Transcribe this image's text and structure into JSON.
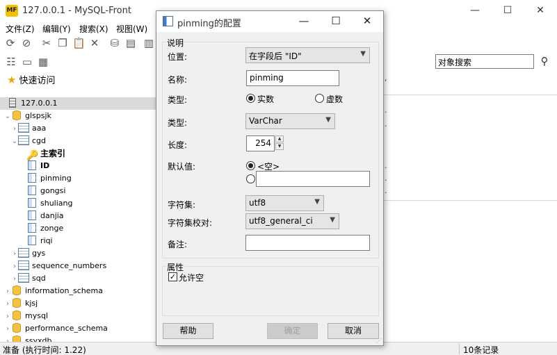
{
  "app": {
    "logo_text": "MF",
    "title": "127.0.0.1 - MySQL-Front"
  },
  "window_controls": {
    "minimize": "—",
    "maximize": "☐",
    "close": "✕"
  },
  "menu": [
    "文件(Z)",
    "编辑(Y)",
    "搜索(X)",
    "视图(W)"
  ],
  "search": {
    "value": "对象搜索"
  },
  "sidebar": {
    "quick_access": "快速访问",
    "tree": [
      {
        "label": "127.0.0.1",
        "icon": "server-icon",
        "selected": true
      },
      {
        "label": "glspsjk",
        "icon": "database-icon",
        "expander": "⌄"
      },
      {
        "label": "aaa",
        "icon": "table-icon",
        "expander": "›"
      },
      {
        "label": "cgd",
        "icon": "table-icon",
        "expander": "⌄"
      },
      {
        "label": "主索引",
        "icon": "key-icon"
      },
      {
        "label": "ID",
        "icon": "column-icon"
      },
      {
        "label": "pinming",
        "icon": "column-icon"
      },
      {
        "label": "gongsi",
        "icon": "column-icon"
      },
      {
        "label": "shuliang",
        "icon": "column-icon"
      },
      {
        "label": "danjia",
        "icon": "column-icon"
      },
      {
        "label": "zonge",
        "icon": "column-icon"
      },
      {
        "label": "riqi",
        "icon": "column-icon"
      },
      {
        "label": "gys",
        "icon": "table-icon",
        "expander": "›"
      },
      {
        "label": "sequence_numbers",
        "icon": "table-icon",
        "expander": "›"
      },
      {
        "label": "sqd",
        "icon": "table-icon",
        "expander": "›"
      },
      {
        "label": "information_schema",
        "icon": "database-icon",
        "expander": "›"
      },
      {
        "label": "kjsj",
        "icon": "database-icon",
        "expander": "›"
      },
      {
        "label": "mysql",
        "icon": "database-icon",
        "expander": "›"
      },
      {
        "label": "performance_schema",
        "icon": "database-icon",
        "expander": "›"
      },
      {
        "label": "ssyxdb",
        "icon": "database-icon",
        "expander": "›"
      }
    ]
  },
  "right_panel": {
    "text_marks": [
      ",",
      ".",
      ".",
      ".",
      ".",
      "."
    ]
  },
  "statusbar": {
    "left": "准备  (执行时间: 1.22)",
    "right": "10条记录"
  },
  "dialog": {
    "title": "pinming的配置",
    "controls": {
      "minimize": "—",
      "maximize": "☐",
      "close": "✕"
    },
    "description_group": "说明",
    "position_label": "位置:",
    "position_value": "在字段后 \"ID\"",
    "name_label": "名称:",
    "name_value": "pinming",
    "kind_label": "类型:",
    "kind_options": [
      "实数",
      "虚数"
    ],
    "kind_selected": "实数",
    "type_label": "类型:",
    "type_value": "VarChar",
    "length_label": "长度:",
    "length_value": "254",
    "default_label": "默认值:",
    "default_options": [
      "<空>",
      ""
    ],
    "charset_label": "字符集:",
    "charset_value": "utf8",
    "collation_label": "字符集校对:",
    "collation_value": "utf8_general_ci",
    "comment_label": "备注:",
    "comment_value": "",
    "attributes_group": "属性",
    "nullable_label": "允许空",
    "nullable_checked": true,
    "help_button": "帮助",
    "ok_button": "确定",
    "cancel_button": "取消"
  },
  "colors": {
    "selection": "#dadada",
    "dialog_bg": "#f0f0f0",
    "db_icon": "#f5c242"
  }
}
